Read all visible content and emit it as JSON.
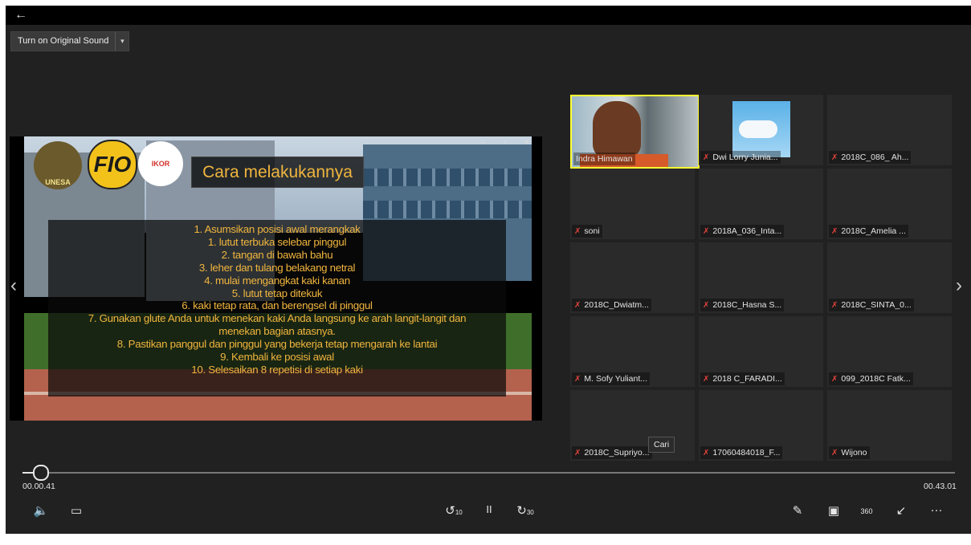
{
  "topbar": {
    "back_icon": "←"
  },
  "sound": {
    "label": "Turn on Original Sound",
    "caret": "▾"
  },
  "presentation": {
    "logo1_text": "UNESA",
    "logo2_text": "FIO",
    "logo3_text": "IKOR",
    "title": "Cara melakukannya",
    "window_controls": "– ▫ ×",
    "steps": [
      "1. Asumsikan posisi awal merangkak",
      "1. lutut terbuka selebar pinggul",
      "2. tangan di bawah bahu",
      "3. leher dan tulang belakang netral",
      "4. mulai mengangkat kaki kanan",
      "5. lutut tetap ditekuk",
      "6. kaki tetap rata, dan berengsel di pinggul",
      "7. Gunakan glute Anda untuk menekan kaki Anda langsung ke arah langit-langit dan",
      "menekan bagian atasnya.",
      "8. Pastikan panggul dan pinggul yang bekerja tetap mengarah ke lantai",
      "9. Kembali ke posisi awal",
      "10. Selesaikan 8 repetisi di setiap kaki"
    ]
  },
  "nav": {
    "prev": "‹",
    "next": "›"
  },
  "participants": [
    {
      "name": "Indra Himawan",
      "muted": false
    },
    {
      "name": "Dwi Lorry Junia...",
      "muted": true
    },
    {
      "name": "2018C_086_ Ah...",
      "muted": true
    },
    {
      "name": "soni",
      "muted": true
    },
    {
      "name": "2018A_036_Inta...",
      "muted": true
    },
    {
      "name": "2018C_Amelia ...",
      "muted": true
    },
    {
      "name": "2018C_Dwiatm...",
      "muted": true
    },
    {
      "name": "2018C_Hasna S...",
      "muted": true
    },
    {
      "name": "2018C_SINTA_0...",
      "muted": true
    },
    {
      "name": "M. Sofy Yuliant...",
      "muted": true
    },
    {
      "name": "2018 C_FARADI...",
      "muted": true
    },
    {
      "name": "099_2018C Fatk...",
      "muted": true
    },
    {
      "name": "2018C_Supriyo...",
      "muted": true
    },
    {
      "name": "17060484018_F...",
      "muted": true
    },
    {
      "name": "Wijono",
      "muted": true
    }
  ],
  "mic_off_icon": "✗",
  "tooltip": {
    "text": "Cari"
  },
  "playback": {
    "current_time": "00.00.41",
    "total_time": "00.43.01",
    "progress_fraction": 0.016
  },
  "controls": {
    "volume_icon": "🔈",
    "captions_icon": "▭",
    "rewind_icon": "↺",
    "rewind_label": "10",
    "pause_icon": "II",
    "forward_icon": "↻",
    "forward_label": "30",
    "pen_icon": "✎",
    "miniview_icon": "▣",
    "view360_icon": "360",
    "exit_fullscreen_icon": "↙",
    "more_icon": "···"
  }
}
